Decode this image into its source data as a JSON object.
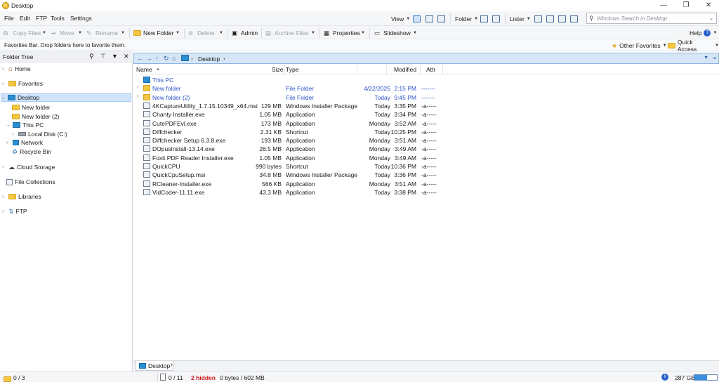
{
  "window": {
    "title": "Desktop"
  },
  "menu": [
    "File",
    "Edit",
    "FTP",
    "Tools",
    "Settings"
  ],
  "view_controls": {
    "view_label": "View",
    "folder_label": "Folder",
    "lister_label": "Lister"
  },
  "search": {
    "placeholder": "Windows Search in Desktop"
  },
  "toolbar": {
    "copy": "Copy Files",
    "move": "Move",
    "rename": "Rename",
    "new_folder": "New Folder",
    "delete": "Delete",
    "admin": "Admin",
    "archive": "Archive Files",
    "properties": "Properties",
    "slideshow": "Slideshow",
    "help": "Help"
  },
  "favorites_bar": {
    "hint": "Favorites Bar. Drop folders here to favorite them.",
    "other": "Other Favorites",
    "quick": "Quick Access"
  },
  "tree": {
    "title": "Folder Tree",
    "nodes": [
      "Home",
      "Favorites",
      "Desktop",
      "New folder",
      "New folder (2)",
      "This PC",
      "Local Disk (C:)",
      "Network",
      "Recycle Bin",
      "Cloud Storage",
      "File Collections",
      "Libraries",
      "FTP"
    ]
  },
  "path": {
    "crumb": "Desktop"
  },
  "columns": {
    "name": "Name",
    "size": "Size",
    "type": "Type",
    "modified": "Modified",
    "attr": "Attr"
  },
  "files": [
    {
      "name": "This PC",
      "size": "",
      "type": "",
      "date": "",
      "time": "",
      "attr": ""
    },
    {
      "name": "New folder",
      "size": "",
      "type": "File Folder",
      "date": "4/22/2025",
      "time": "2:15 PM",
      "attr": "-------"
    },
    {
      "name": "New folder (2)",
      "size": "",
      "type": "File Folder",
      "date": "Today",
      "time": "9:45 PM",
      "attr": "-------"
    },
    {
      "name": "4KCaptureUtility_1.7.15.10349_x64.msi",
      "size": "129 MB",
      "type": "Windows Installer Package",
      "date": "Today",
      "time": "3:35 PM",
      "attr": "-a-----"
    },
    {
      "name": "Chanty Installer.exe",
      "size": "1.05 MB",
      "type": "Application",
      "date": "Today",
      "time": "3:34 PM",
      "attr": "-a-----"
    },
    {
      "name": "CutePDFEvl.exe",
      "size": "173 MB",
      "type": "Application",
      "date": "Monday",
      "time": "3:52 AM",
      "attr": "-a-----"
    },
    {
      "name": "Diffchecker",
      "size": "2.31 KB",
      "type": "Shortcut",
      "date": "Today",
      "time": "10:25 PM",
      "attr": "-a-----"
    },
    {
      "name": "Diffchecker Setup 6.3.8.exe",
      "size": "193 MB",
      "type": "Application",
      "date": "Monday",
      "time": "3:51 AM",
      "attr": "-a-----"
    },
    {
      "name": "DOpusInstall-13.14.exe",
      "size": "26.5 MB",
      "type": "Application",
      "date": "Monday",
      "time": "3:49 AM",
      "attr": "-a-----"
    },
    {
      "name": "Foxit PDF Reader Installer.exe",
      "size": "1.05 MB",
      "type": "Application",
      "date": "Monday",
      "time": "3:49 AM",
      "attr": "-a-----"
    },
    {
      "name": "QuickCPU",
      "size": "990 bytes",
      "type": "Shortcut",
      "date": "Today",
      "time": "10:36 PM",
      "attr": "-a-----"
    },
    {
      "name": "QuickCpuSetup.msi",
      "size": "34.8 MB",
      "type": "Windows Installer Package",
      "date": "Today",
      "time": "3:36 PM",
      "attr": "-a-----"
    },
    {
      "name": "RCleaner-Installer.exe",
      "size": "566 KB",
      "type": "Application",
      "date": "Monday",
      "time": "3:51 AM",
      "attr": "-a-----"
    },
    {
      "name": "VidCoder-11.11.exe",
      "size": "43.3 MB",
      "type": "Application",
      "date": "Today",
      "time": "3:38 PM",
      "attr": "-a-----"
    }
  ],
  "tabs": {
    "active": "Desktop",
    "add": "+"
  },
  "status": {
    "folders": "0 / 3",
    "files": "0 / 11",
    "hidden": "2 hidden",
    "bytes": "0 bytes / 602 MB",
    "free": "287 GB",
    "disk_used_fraction": 0.55
  },
  "colors": {
    "accent": "#2a52c9",
    "selection": "#cfe3fb",
    "hidden": "#d01818"
  }
}
